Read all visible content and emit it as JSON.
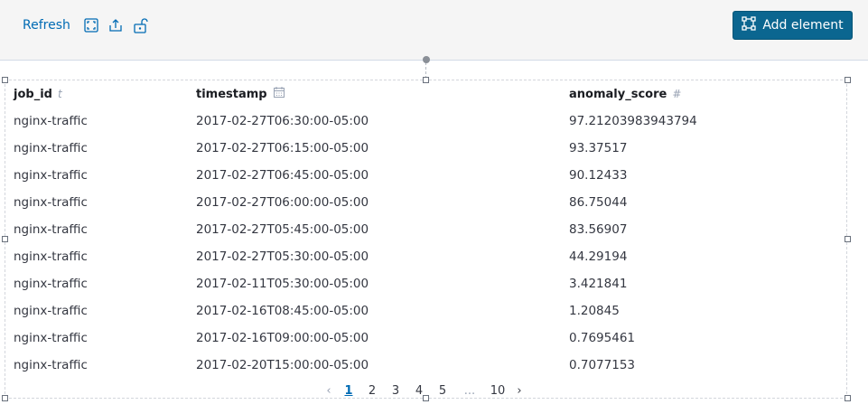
{
  "toolbar": {
    "refresh_label": "Refresh",
    "icons": [
      "fullscreen-icon",
      "share-icon",
      "unlock-icon"
    ],
    "add_element_label": "Add element",
    "accent": "#0b6690"
  },
  "table": {
    "columns": [
      {
        "label": "job_id",
        "type_icon": "t"
      },
      {
        "label": "timestamp",
        "type_icon": "calendar-icon"
      },
      {
        "label": "anomaly_score",
        "type_icon": "#"
      }
    ],
    "rows": [
      [
        "nginx-traffic",
        "2017-02-27T06:30:00-05:00",
        "97.21203983943794"
      ],
      [
        "nginx-traffic",
        "2017-02-27T06:15:00-05:00",
        "93.37517"
      ],
      [
        "nginx-traffic",
        "2017-02-27T06:45:00-05:00",
        "90.12433"
      ],
      [
        "nginx-traffic",
        "2017-02-27T06:00:00-05:00",
        "86.75044"
      ],
      [
        "nginx-traffic",
        "2017-02-27T05:45:00-05:00",
        "83.56907"
      ],
      [
        "nginx-traffic",
        "2017-02-27T05:30:00-05:00",
        "44.29194"
      ],
      [
        "nginx-traffic",
        "2017-02-11T05:30:00-05:00",
        "3.421841"
      ],
      [
        "nginx-traffic",
        "2017-02-16T08:45:00-05:00",
        "1.20845"
      ],
      [
        "nginx-traffic",
        "2017-02-16T09:00:00-05:00",
        "0.7695461"
      ],
      [
        "nginx-traffic",
        "2017-02-20T15:00:00-05:00",
        "0.7077153"
      ]
    ]
  },
  "pagination": {
    "prev": "‹",
    "next": "›",
    "pages": [
      "1",
      "2",
      "3",
      "4",
      "5",
      "...",
      "10"
    ],
    "current": "1"
  }
}
